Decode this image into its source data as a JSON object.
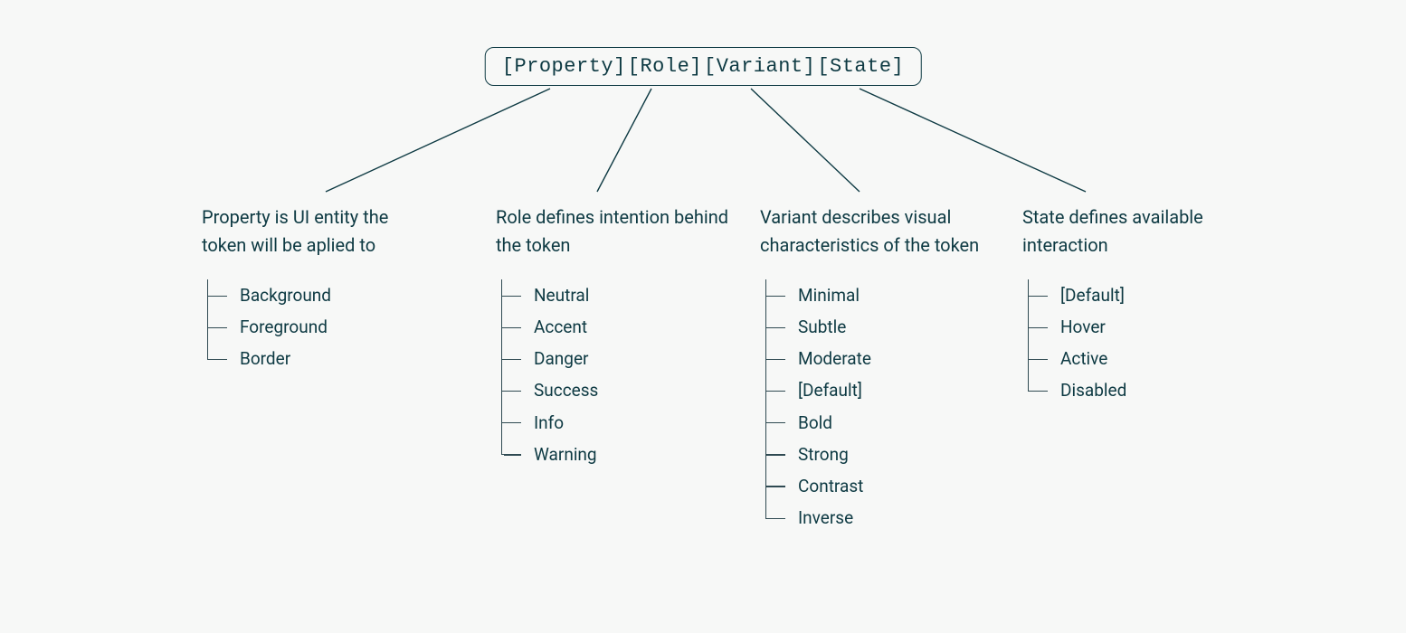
{
  "pattern": {
    "parts": [
      "[Property]",
      "[Role]",
      "[Variant]",
      "[State]"
    ]
  },
  "columns": {
    "property": {
      "desc": "Property is UI entity the token will be aplied to",
      "items": [
        "Background",
        "Foreground",
        "Border"
      ]
    },
    "role": {
      "desc": "Role defines intention behind the token",
      "items": [
        "Neutral",
        "Accent",
        "Danger",
        "Success",
        "Info",
        "Warning"
      ]
    },
    "variant": {
      "desc": "Variant describes visual characteristics of the token",
      "items": [
        "Minimal",
        "Subtle",
        "Moderate",
        "[Default]",
        "Bold",
        "Strong",
        "Contrast",
        "Inverse"
      ]
    },
    "state": {
      "desc": "State defines available interaction",
      "items": [
        "[Default]",
        "Hover",
        "Active",
        "Disabled"
      ]
    }
  }
}
